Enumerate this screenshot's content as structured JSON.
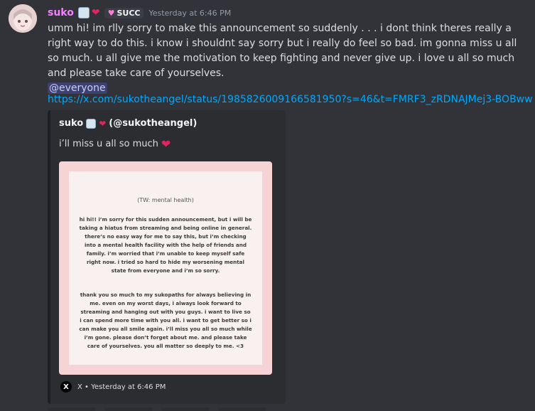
{
  "message": {
    "username": "suko",
    "tag_label": "SUCC",
    "timestamp": "Yesterday at 6:46 PM",
    "text": "umm hi! im rlly sorry to make this announcement so suddenly . . . i dont think theres really a right way to do this. i know i shouldnt say sorry but i really do feel so bad. im gonna miss u all so much. u all give me the motivation to keep fighting and never give up. i love u all so much and please take care of yourselves.",
    "mention": "@everyone",
    "link": "https://x.com/sukotheangel/status/1985826009166581950?s=46&t=FMRF3_zRDNAJMej3-BOBww"
  },
  "embed": {
    "author_name": "suko",
    "author_handle": "(@sukotheangel)",
    "description": "i’ll miss u all so much",
    "image_title": "(TW: mental health)",
    "image_paragraph_1": "hi hi!! i’m sorry for this sudden announcement, but i will be taking a hiatus from streaming and being online in general. there’s no easy way for me to say this, but i’m checking into a mental health facility with the help of friends and family. i’m worried that i’m unable to keep myself safe right now. i tried so hard to hide my worsening mental state from everyone and i’m so sorry.",
    "image_paragraph_2": "thank you so much to my sukopaths for always believing in me. even on my worst days, i always look forward to streaming and hanging out with you guys. i want to live so i can spend more time with you all. i want to get better so i can make you all smile again. i’ll miss you all so much while i’m gone. please don’t forget about me. and please take care of yourselves. you all matter so deeply to me. <3",
    "footer": "X • Yesterday at 6:46 PM"
  },
  "colors": {
    "username": "#f47fff",
    "link": "#00a8fc",
    "heart": "#e0245e"
  },
  "icons": [
    "avatar",
    "badge-emoji",
    "heart-icon",
    "succ-tag-icon",
    "x-logo-icon"
  ]
}
